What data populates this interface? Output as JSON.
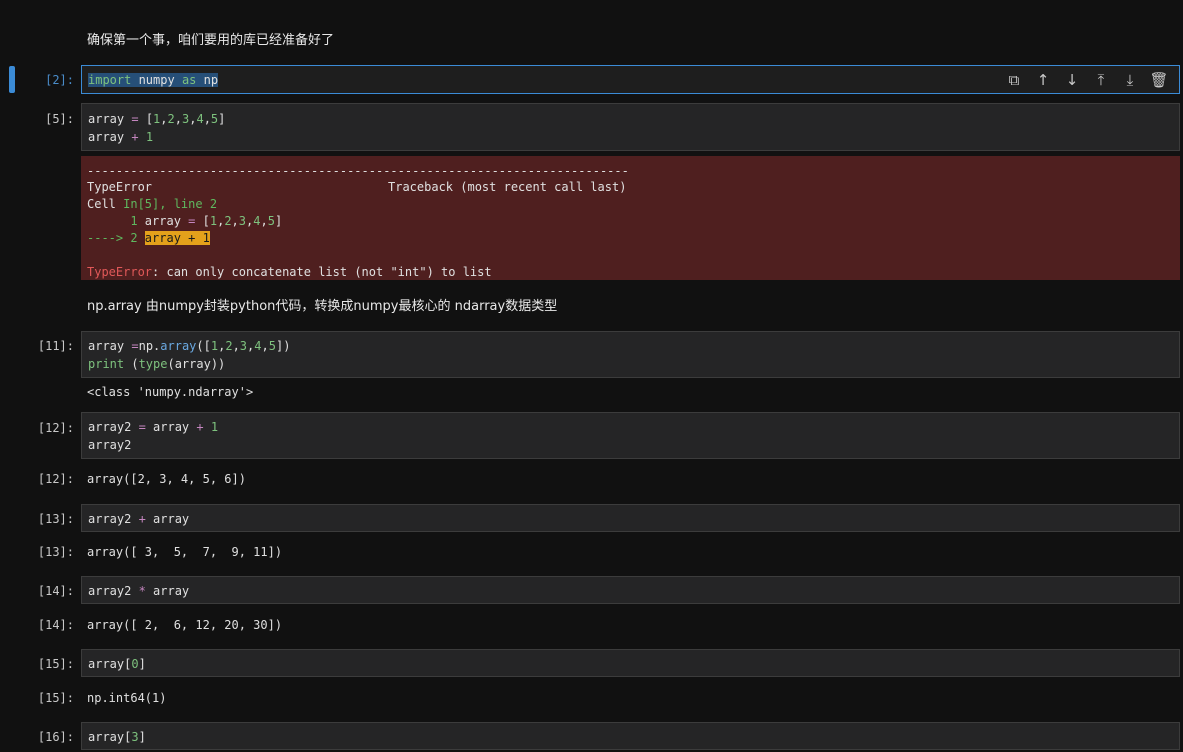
{
  "markdown": {
    "intro": "确保第一个事，咱们要用的库已经准备好了",
    "np_array_desc": "np.array 由numpy封装python代码，转换成numpy最核心的 ndarray数据类型"
  },
  "cells": {
    "c2": {
      "prompt": "[2]:"
    },
    "c5": {
      "prompt": "[5]:"
    },
    "c11": {
      "prompt": "[11]:",
      "output": "<class 'numpy.ndarray'>"
    },
    "c12": {
      "prompt": "[12]:",
      "out_prompt": "[12]:",
      "output": "array([2, 3, 4, 5, 6])"
    },
    "c13": {
      "prompt": "[13]:",
      "out_prompt": "[13]:",
      "output": "array([ 3,  5,  7,  9, 11])"
    },
    "c14": {
      "prompt": "[14]:",
      "out_prompt": "[14]:",
      "output": "array([ 2,  6, 12, 20, 30])"
    },
    "c15": {
      "prompt": "[15]:",
      "out_prompt": "[15]:",
      "output": "np.int64(1)"
    },
    "c16": {
      "prompt": "[16]:"
    }
  },
  "error": {
    "dashes": "---------------------------------------------------------------------------",
    "type": "TypeError",
    "traceback": "Traceback (most recent call last)",
    "cell_prefix": "Cell ",
    "cell_ref": "In[5], line 2",
    "line1_num": "      1 ",
    "arrow": "----> 2 ",
    "msg_type": "TypeError",
    "msg": ": can only concatenate list (not \"int\") to list"
  },
  "toolbar": {
    "icons": [
      "copy-icon",
      "arrow-up-icon",
      "arrow-down-icon",
      "insert-above-icon",
      "insert-below-icon",
      "delete-icon"
    ]
  },
  "colors": {
    "accent": "#3b8bd6",
    "error_bg": "#4f1f1f",
    "highlight": "#e4a11b"
  }
}
